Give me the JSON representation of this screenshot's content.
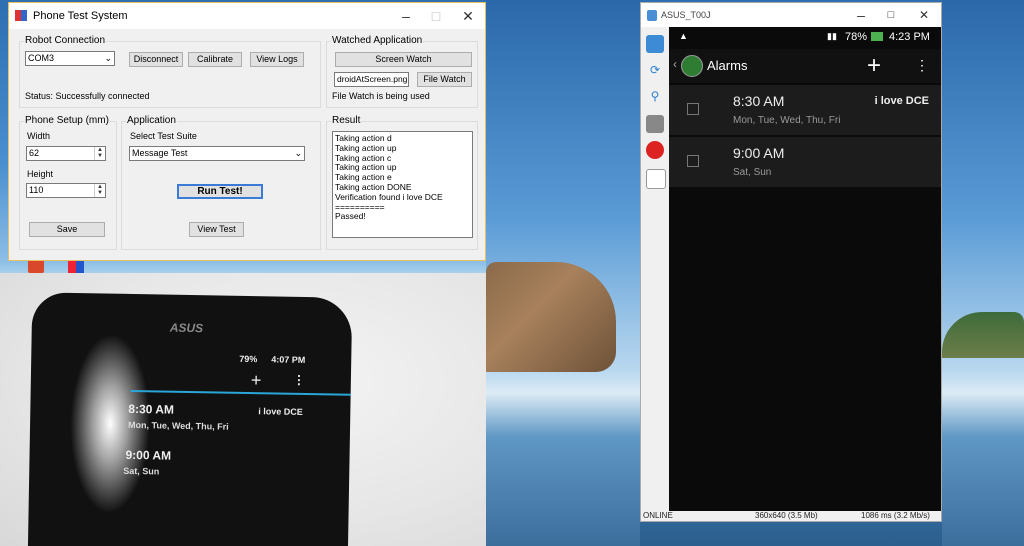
{
  "main_window": {
    "title": "Phone Test System",
    "robot_connection": {
      "group_label": "Robot Connection",
      "port": "COM3",
      "disconnect_label": "Disconnect",
      "calibrate_label": "Calibrate",
      "view_logs_label": "View Logs",
      "status": "Status: Successfully connected"
    },
    "watched_application": {
      "group_label": "Watched Application",
      "screen_watch_label": "Screen Watch",
      "file_field": "droidAtScreen.png",
      "file_watch_label": "File Watch",
      "file_watch_status": "File Watch is being used"
    },
    "phone_setup": {
      "group_label": "Phone Setup (mm)",
      "width_label": "Width",
      "width_value": "62",
      "height_label": "Height",
      "height_value": "110",
      "save_label": "Save"
    },
    "application": {
      "group_label": "Application",
      "suite_label": "Select Test Suite",
      "suite_value": "Message Test",
      "run_label": "Run Test!",
      "view_test_label": "View Test"
    },
    "result": {
      "group_label": "Result",
      "lines": [
        "Taking action d",
        "Taking action up",
        "Taking action c",
        "Taking action up",
        "Taking action e",
        "Taking action DONE",
        "Verification found i love DCE",
        "==========",
        "Passed!"
      ]
    }
  },
  "camera_phone": {
    "brand": "ASUS",
    "battery": "79%",
    "clock": "4:07 PM",
    "alarm1_time": "8:30 AM",
    "alarm1_label": "i love DCE",
    "alarm1_days": "Mon, Tue, Wed, Thu, Fri",
    "alarm2_time": "9:00 AM",
    "alarm2_days": "Sat, Sun"
  },
  "emulator_window": {
    "title": "ASUS_T00J",
    "status_left": "ONLINE",
    "status_mid": "360x640 (3.5 Mb)",
    "status_right": "1086 ms (3.2 Mb/s)",
    "phone": {
      "battery": "78%",
      "clock": "4:23 PM",
      "app_title": "Alarms",
      "alarms": [
        {
          "time": "8:30 AM",
          "days": "Mon, Tue, Wed, Thu, Fri",
          "label": "i love DCE"
        },
        {
          "time": "9:00 AM",
          "days": "Sat, Sun",
          "label": ""
        }
      ]
    }
  }
}
